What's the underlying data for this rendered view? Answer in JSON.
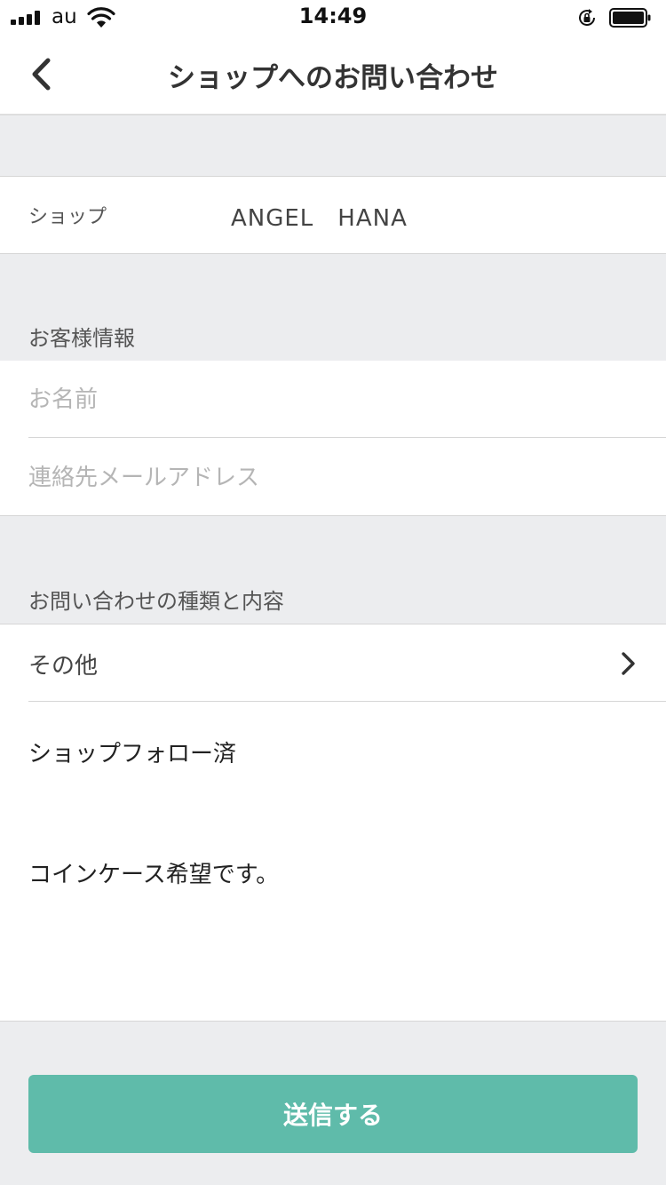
{
  "status_bar": {
    "carrier": "au",
    "time": "14:49",
    "icons": [
      "signal-bars-icon",
      "wifi-icon",
      "orientation-lock-icon",
      "battery-icon"
    ]
  },
  "nav": {
    "title": "ショップへのお問い合わせ",
    "back_icon": "chevron-left-icon"
  },
  "shop": {
    "label": "ショップ",
    "value": "ANGEL　HANA"
  },
  "customer_info": {
    "header": "お客様情報",
    "name_placeholder": "お名前",
    "email_placeholder": "連絡先メールアドレス"
  },
  "inquiry": {
    "header": "お問い合わせの種類と内容",
    "type_value": "その他",
    "chevron_icon": "chevron-right-icon",
    "message": "ショップフォロー済\n\nコインケース希望です。"
  },
  "submit": {
    "label": "送信する"
  },
  "colors": {
    "accent": "#5fbbaa",
    "background": "#ecedef",
    "surface": "#ffffff",
    "divider": "#d6d6d6",
    "placeholder": "#b5b5b5"
  }
}
